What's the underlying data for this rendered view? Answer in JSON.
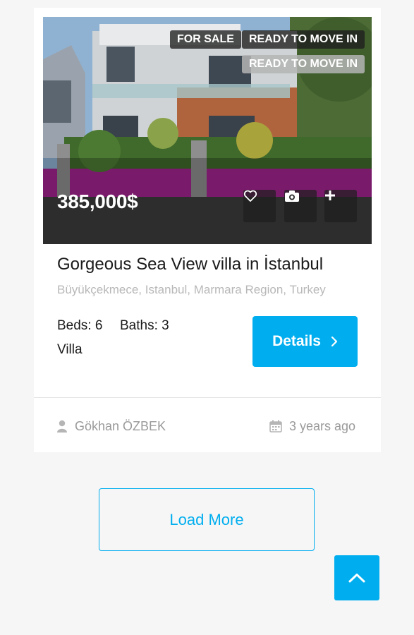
{
  "listing": {
    "badges": {
      "status": "FOR SALE",
      "label_primary": "READY TO MOVE IN",
      "label_secondary": "READY TO MOVE IN"
    },
    "price": "385,000$",
    "title": "Gorgeous Sea View villa in İstanbul",
    "address": "Büyükçekmece, Istanbul, Marmara Region, Turkey",
    "beds": "Beds: 6",
    "baths": "Baths: 3",
    "type": "Villa",
    "details_label": "Details",
    "agent": "Gökhan ÖZBEK",
    "posted": "3 years ago",
    "actions": [
      "heart-icon",
      "camera-icon",
      "plus-icon"
    ]
  },
  "pagination": {
    "load_more_label": "Load More"
  },
  "colors": {
    "accent": "#00aeef",
    "text": "#1b1b1b",
    "muted": "#b8b8b8"
  }
}
